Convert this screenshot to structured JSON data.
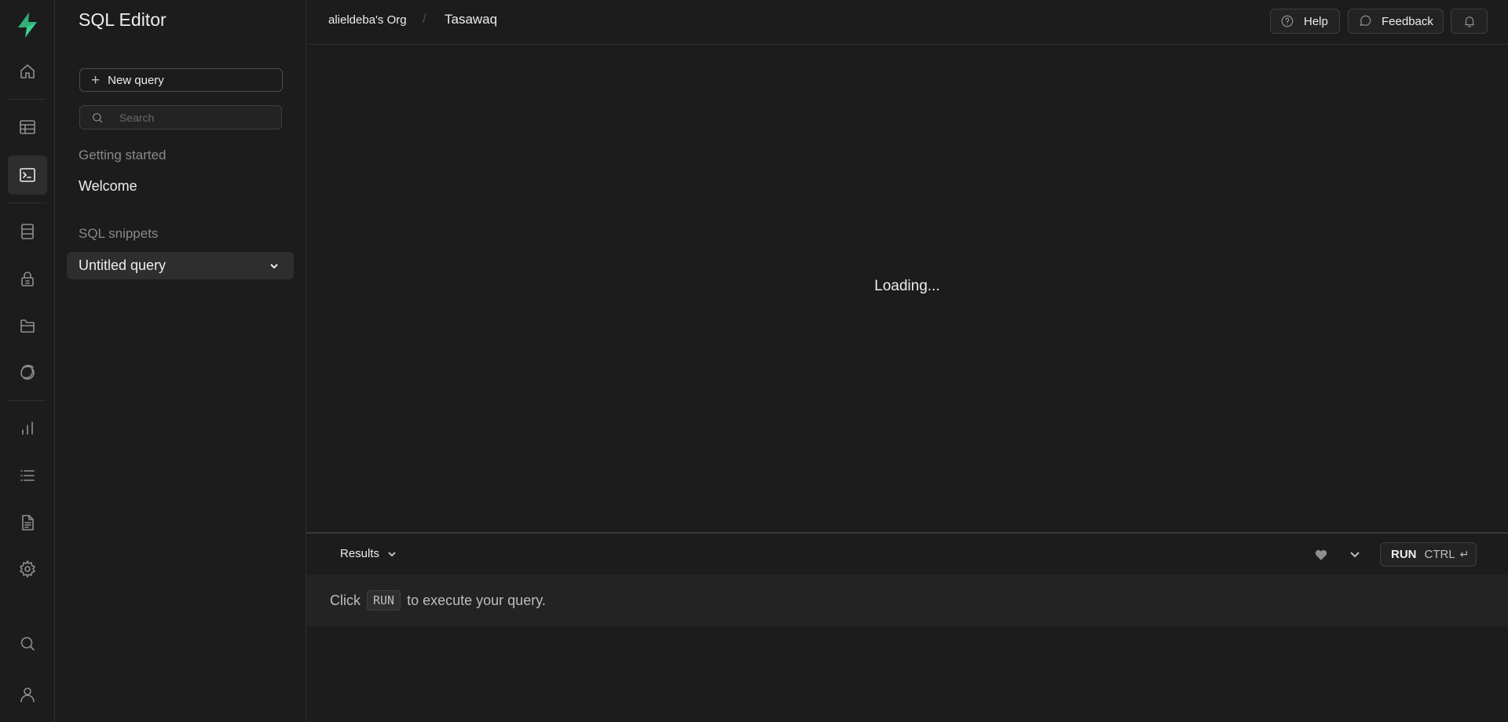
{
  "sidebar_rail": {
    "items": [
      "home-icon",
      "table-editor-icon",
      "sql-editor-icon",
      "database-icon",
      "auth-icon",
      "storage-icon",
      "realtime-icon",
      "reports-icon",
      "logs-icon",
      "api-docs-icon",
      "settings-icon",
      "search-icon",
      "user-icon"
    ],
    "active": "sql-editor-icon",
    "brand_color": "#3ecf8e"
  },
  "panel": {
    "title": "SQL Editor",
    "new_query_label": "New query",
    "search_placeholder": "Search",
    "getting_started_label": "Getting started",
    "welcome_label": "Welcome",
    "snippets_label": "SQL snippets",
    "snippet_item": "Untitled query"
  },
  "header": {
    "org": "alieldeba's Org",
    "separator": "/",
    "project": "Tasawaq",
    "help_label": "Help",
    "feedback_label": "Feedback"
  },
  "editor": {
    "loading_text": "Loading..."
  },
  "results": {
    "tab_label": "Results",
    "run_label": "RUN",
    "shortcut_label": "CTRL",
    "enter_symbol": "↵",
    "hint_prefix": "Click",
    "hint_code": "RUN",
    "hint_suffix": "to execute your query."
  }
}
